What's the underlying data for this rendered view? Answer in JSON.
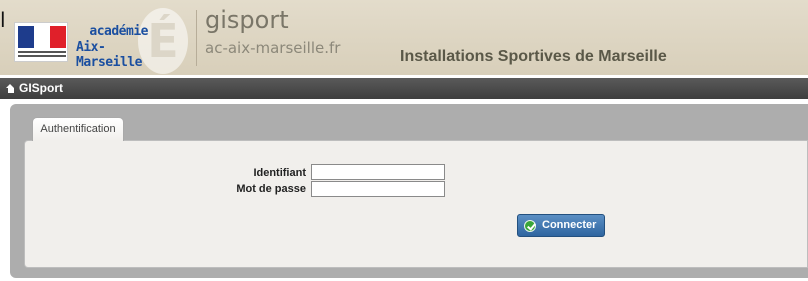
{
  "header": {
    "stray_text": "l",
    "academie_line1": "académie",
    "academie_line2": "Aix-Marseille",
    "brand_name": "gisport",
    "brand_domain": "ac-aix-marseille.fr",
    "app_title": "Installations Sportives de Marseille",
    "flag_colors": [
      "#1e3c8c",
      "#ffffff",
      "#e0202a"
    ]
  },
  "navbar": {
    "home_icon": "home-icon",
    "label": "GISport"
  },
  "auth": {
    "tab_label": "Authentification",
    "username_label": "Identifiant",
    "username_value": "",
    "password_label": "Mot de passe",
    "password_value": "",
    "submit_label": "Connecter",
    "submit_icon": "check-circle-icon",
    "submit_color": "#2f65a0"
  }
}
